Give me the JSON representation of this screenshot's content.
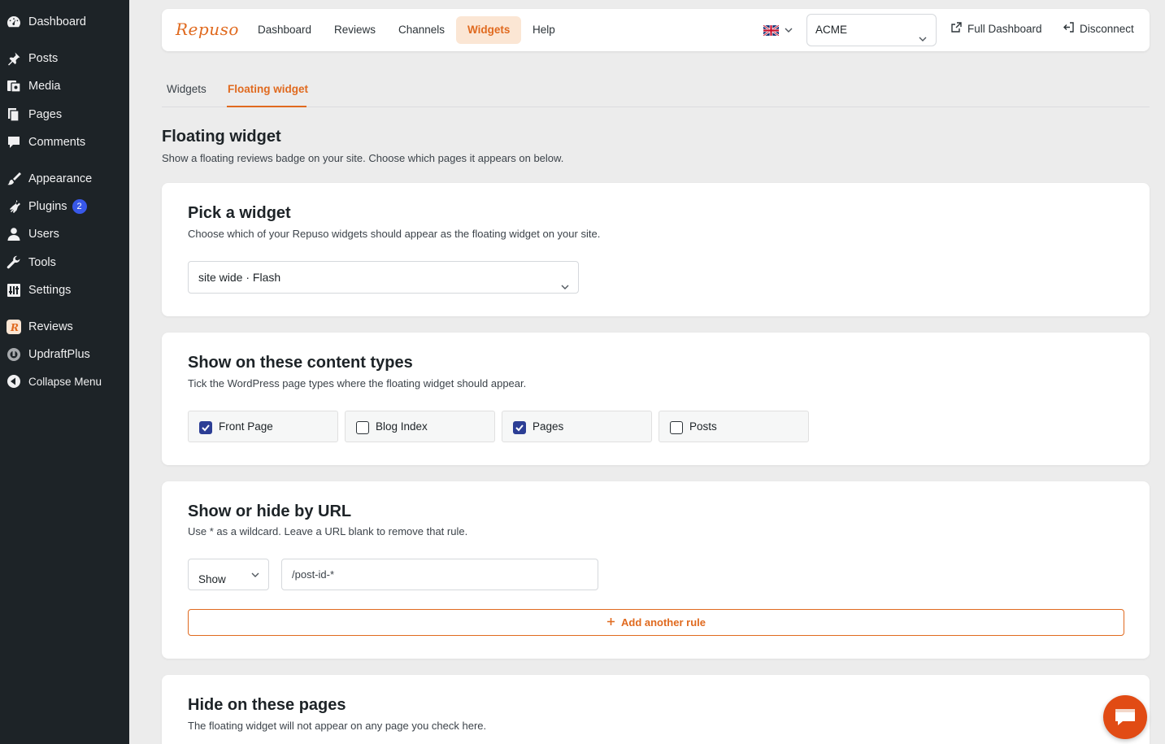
{
  "sidebar": {
    "items": [
      {
        "label": "Dashboard",
        "icon": "dashboard-icon"
      },
      {
        "label": "Posts",
        "icon": "pin-icon"
      },
      {
        "label": "Media",
        "icon": "media-icon"
      },
      {
        "label": "Pages",
        "icon": "pages-icon"
      },
      {
        "label": "Comments",
        "icon": "comment-icon"
      },
      {
        "label": "Appearance",
        "icon": "brush-icon"
      },
      {
        "label": "Plugins",
        "icon": "plugin-icon",
        "badge": "2"
      },
      {
        "label": "Users",
        "icon": "user-icon"
      },
      {
        "label": "Tools",
        "icon": "wrench-icon"
      },
      {
        "label": "Settings",
        "icon": "settings-icon"
      },
      {
        "label": "Reviews",
        "icon": "repuso-icon"
      },
      {
        "label": "UpdraftPlus",
        "icon": "updraft-icon"
      },
      {
        "label": "Collapse Menu",
        "icon": "collapse-icon"
      }
    ],
    "badge_color": "#3858e9"
  },
  "topnav": {
    "logo": "Repuso",
    "links": [
      "Dashboard",
      "Reviews",
      "Channels",
      "Widgets",
      "Help"
    ],
    "active_link": "Widgets",
    "language_icon": "uk-flag-icon",
    "account": "ACME",
    "full_dashboard": "Full Dashboard",
    "disconnect": "Disconnect",
    "accent": "#e06a1f"
  },
  "subtabs": {
    "widgets": "Widgets",
    "floating": "Floating widget"
  },
  "page": {
    "title": "Floating widget",
    "subtitle": "Show a floating reviews badge on your site. Choose which pages it appears on below."
  },
  "pick_widget": {
    "title": "Pick a widget",
    "subtitle": "Choose which of your Repuso widgets should appear as the floating widget on your site.",
    "selected": "site wide · Flash"
  },
  "content_types": {
    "title": "Show on these content types",
    "subtitle": "Tick the WordPress page types where the floating widget should appear.",
    "options": [
      {
        "label": "Front Page",
        "checked": true
      },
      {
        "label": "Blog Index",
        "checked": false
      },
      {
        "label": "Pages",
        "checked": true
      },
      {
        "label": "Posts",
        "checked": false
      }
    ]
  },
  "url_rules": {
    "title": "Show or hide by URL",
    "subtitle": "Use * as a wildcard. Leave a URL blank to remove that rule.",
    "rule_mode": "Show",
    "rule_url": "/post-id-*",
    "add_label": "Add another rule"
  },
  "hide_pages": {
    "title": "Hide on these pages",
    "subtitle": "The floating widget will not appear on any page you check here."
  },
  "chat": {
    "icon": "chat-icon",
    "color": "#e14b14"
  }
}
